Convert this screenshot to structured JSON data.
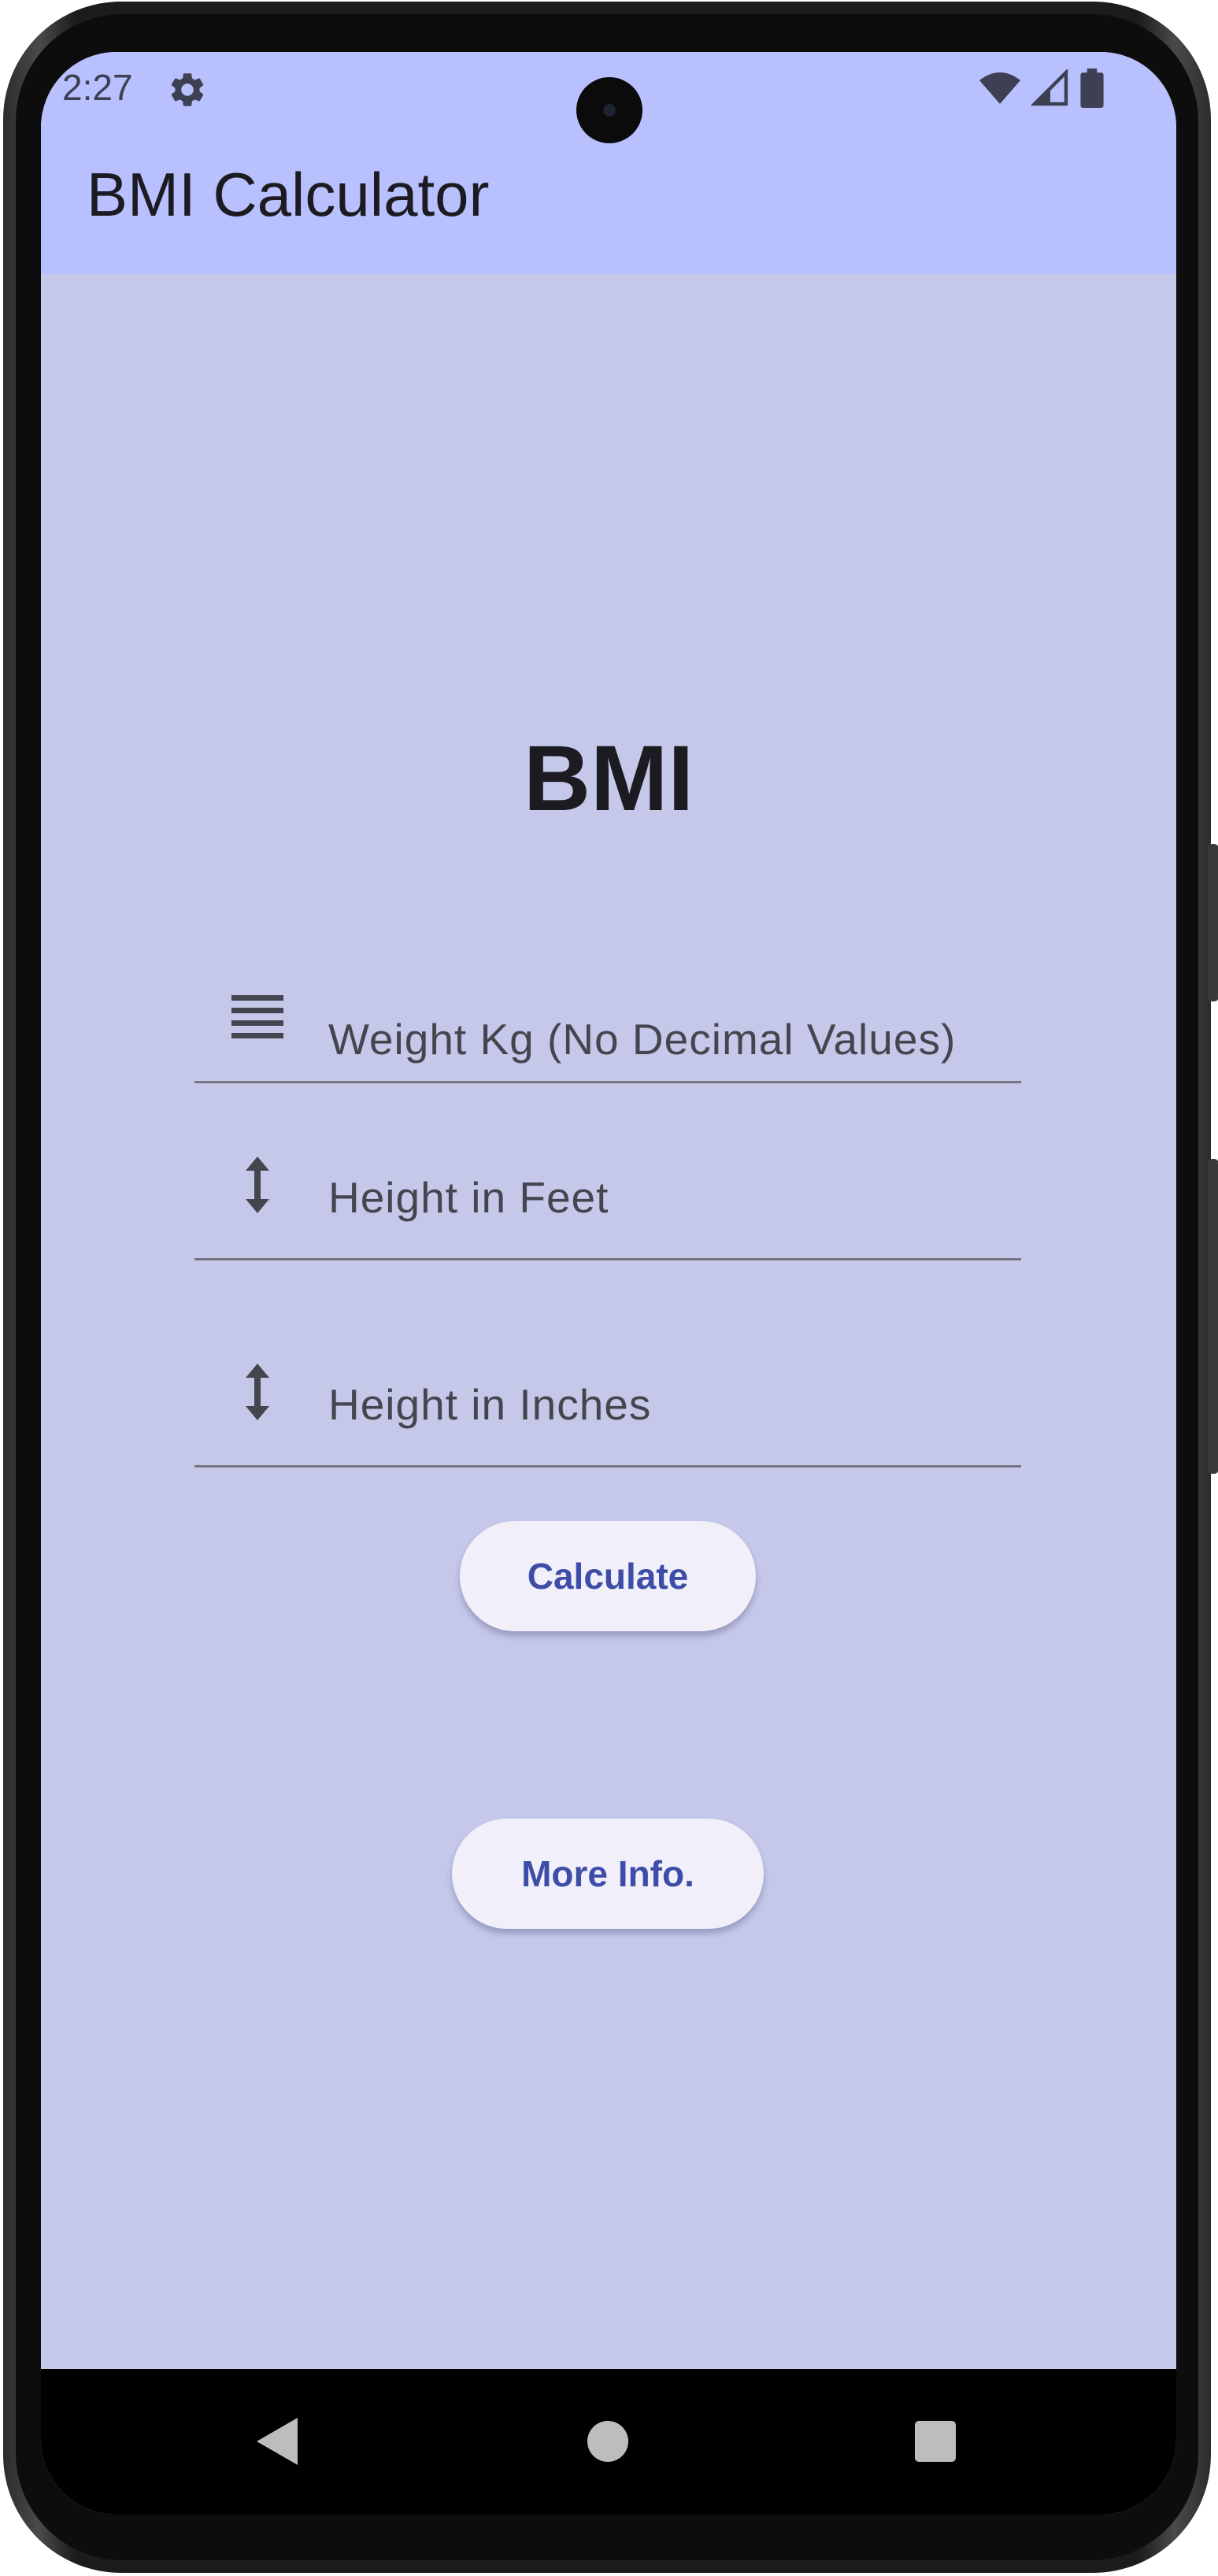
{
  "status_bar": {
    "time": "2:27",
    "icons": [
      "settings-gear-icon",
      "wifi-icon",
      "signal-icon",
      "battery-icon"
    ]
  },
  "app_bar": {
    "title": "BMI Calculator",
    "color": "#b8c0fd"
  },
  "main": {
    "heading": "BMI",
    "background": "#c5c8e8",
    "fields": [
      {
        "icon": "weight-lines-icon",
        "placeholder": "Weight Kg (No Decimal Values)",
        "value": ""
      },
      {
        "icon": "height-arrows-icon",
        "placeholder": "Height in Feet",
        "value": ""
      },
      {
        "icon": "height-arrows-icon",
        "placeholder": "Height in Inches",
        "value": ""
      }
    ],
    "calculate_button": "Calculate",
    "more_info_button": "More Info.",
    "button_text_color": "#3e4da8"
  },
  "nav_bar": {
    "items": [
      "back-triangle-icon",
      "home-circle-icon",
      "recents-square-icon"
    ]
  }
}
